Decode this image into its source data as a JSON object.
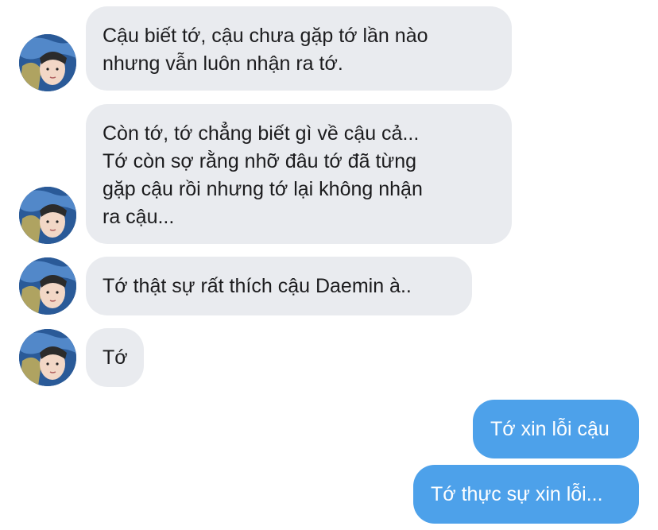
{
  "messages": [
    {
      "side": "incoming",
      "avatar": "contact-avatar",
      "text": "Cậu biết tớ, cậu chưa gặp tớ lần nào\nnhưng vẫn luôn nhận ra tớ."
    },
    {
      "side": "incoming",
      "avatar": "contact-avatar",
      "text": "Còn tớ, tớ chẳng biết gì về cậu cả...\nTớ còn sợ rằng nhỡ đâu tớ đã từng\ngặp cậu rồi nhưng tớ lại không nhận\nra cậu..."
    },
    {
      "side": "incoming",
      "avatar": "contact-avatar",
      "text": "Tớ thật sự rất thích cậu Daemin à.."
    },
    {
      "side": "incoming",
      "avatar": "contact-avatar",
      "text": "Tớ"
    },
    {
      "side": "outgoing",
      "text": "Tớ xin lỗi cậu"
    },
    {
      "side": "outgoing",
      "text": "Tớ thực sự xin lỗi..."
    }
  ],
  "colors": {
    "incoming_bubble": "#e9ebef",
    "outgoing_bubble": "#4da1ea",
    "incoming_text": "#1c1c1e",
    "outgoing_text": "#ffffff"
  }
}
